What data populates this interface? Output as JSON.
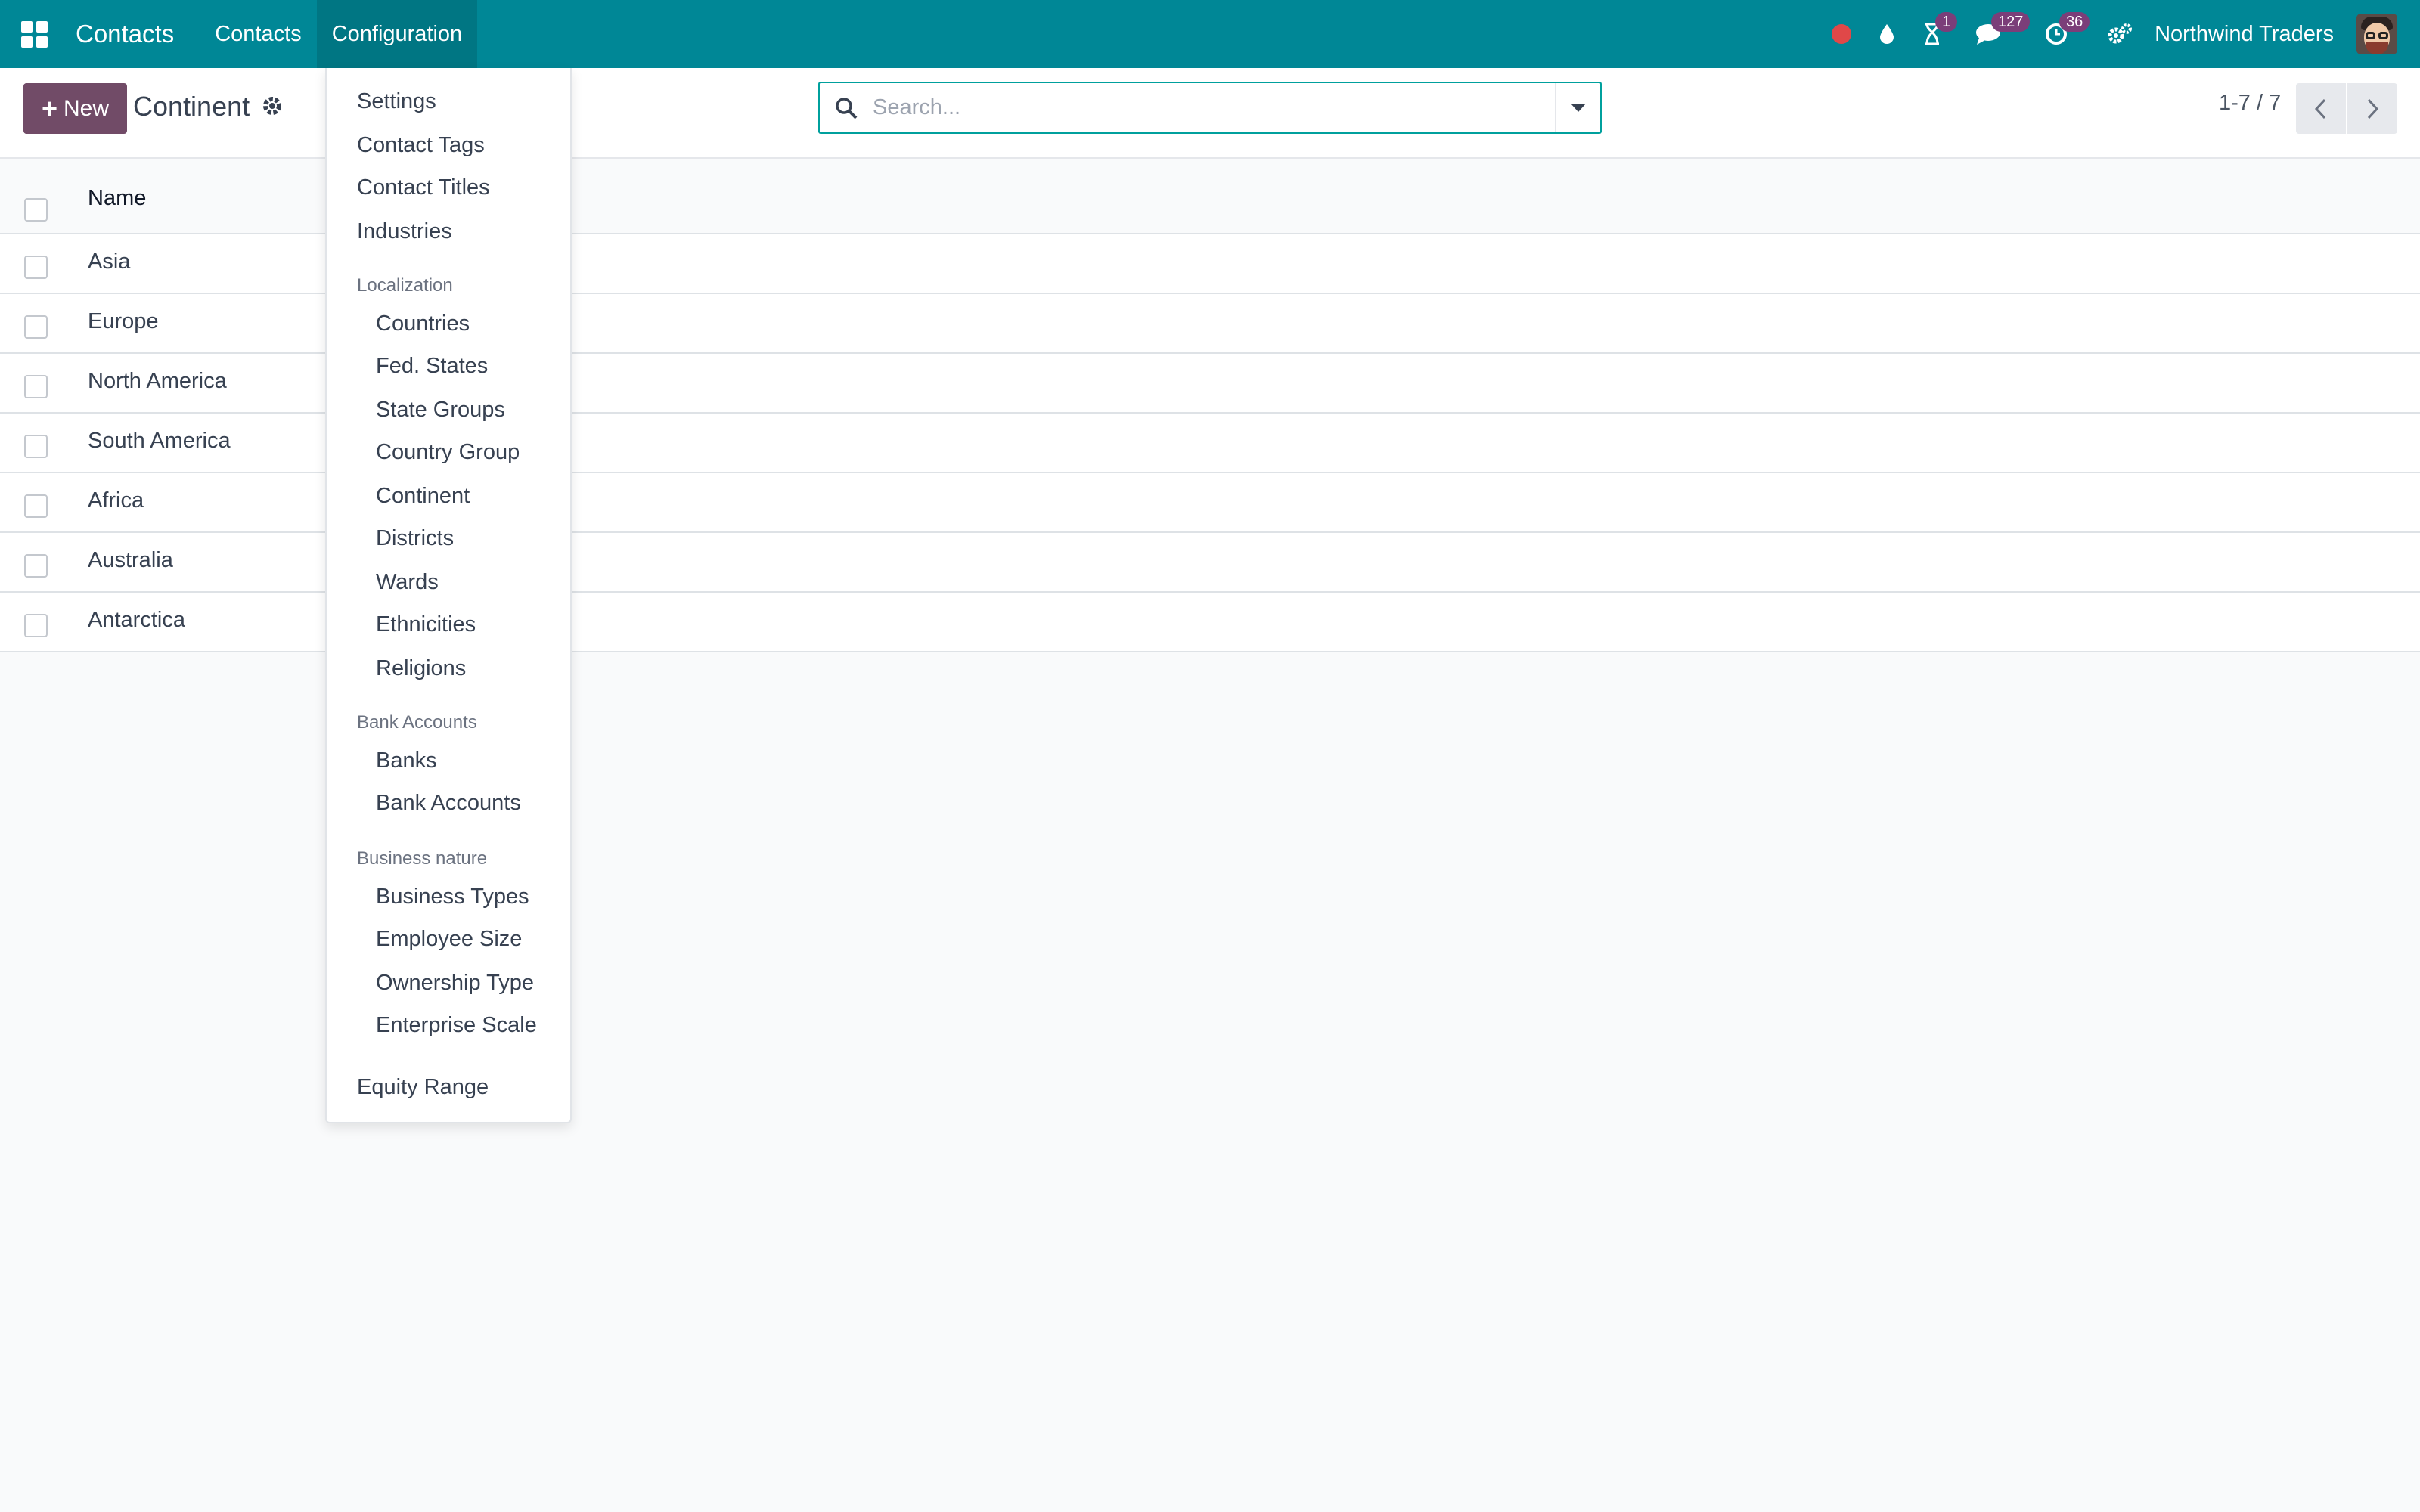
{
  "navbar": {
    "app_name": "Contacts",
    "menu": [
      {
        "label": "Contacts"
      },
      {
        "label": "Configuration"
      }
    ],
    "badges": {
      "activities": "1",
      "messages": "127",
      "timer": "36"
    },
    "company": "Northwind Traders"
  },
  "control_panel": {
    "new_label": "New",
    "title": "Continent",
    "search_placeholder": "Search...",
    "pager": "1-7 / 7"
  },
  "list": {
    "column_name": "Name",
    "rows": [
      "Asia",
      "Europe",
      "North America",
      "South America",
      "Africa",
      "Australia",
      "Antarctica"
    ]
  },
  "config_menu": {
    "settings": "Settings",
    "contact_tags": "Contact Tags",
    "contact_titles": "Contact Titles",
    "industries": "Industries",
    "localization_header": "Localization",
    "localization": [
      "Countries",
      "Fed. States",
      "State Groups",
      "Country Group",
      "Continent",
      "Districts",
      "Wards",
      "Ethnicities",
      "Religions"
    ],
    "bank_header": "Bank Accounts",
    "bank": [
      "Banks",
      "Bank Accounts"
    ],
    "business_header": "Business nature",
    "business": [
      "Business Types",
      "Employee Size",
      "Ownership Type",
      "Enterprise Scale"
    ],
    "equity_range": "Equity Range"
  },
  "colors": {
    "navbar": "#008796",
    "primary_button": "#714b67",
    "badge": "#7b3e79",
    "search_border": "#00a09d",
    "recording_dot": "#e04848"
  }
}
